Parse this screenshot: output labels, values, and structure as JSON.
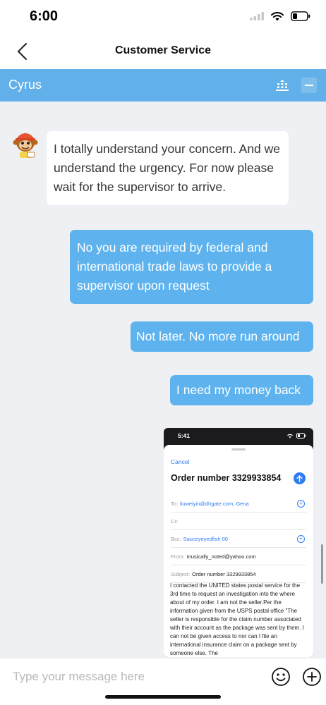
{
  "status_bar": {
    "time": "6:00"
  },
  "nav": {
    "title": "Customer Service",
    "back_icon": "chevron-left-icon"
  },
  "agent_bar": {
    "name": "Cyrus",
    "color": "#62b0ea"
  },
  "messages": [
    {
      "from": "agent",
      "text": "I totally understand your concern. And we understand the urgency. For now please wait for the supervisor to arrive."
    },
    {
      "from": "user",
      "text": "No you are required by federal and international trade laws to provide a supervisor upon request"
    },
    {
      "from": "user",
      "text": "Not later. No more run around"
    },
    {
      "from": "user",
      "text": "I need my money back"
    }
  ],
  "attachment": {
    "time": "5:41",
    "cancel": "Cancel",
    "subject_title": "Order number 3329933854",
    "to_label": "To:",
    "to_value": "liuweiyin@dhgate.com, Gena",
    "cc_label": "Cc:",
    "bcc_label": "Bcc:",
    "bcc_value": "Sauceyeyedfish 00",
    "from_label": "From:",
    "from_value": "musically_noted@yahoo.com",
    "subject_label": "Subject:",
    "subject_value": "Order number 3329933854",
    "body": "I contacted the UNITED states postal service for the 3rd time to request an investigation into the where about of my order. I am not the seller.Per the information given from the USPS postal office \"The seller is responsible for the claim number associated with their account as the package was sent by them. I can not be given access to nor can I file an international insurance claim on a package sent by someone else. The"
  },
  "input": {
    "placeholder": "Type your message here"
  },
  "colors": {
    "accent": "#5eb3ee",
    "link_blue": "#2f7bf0"
  }
}
